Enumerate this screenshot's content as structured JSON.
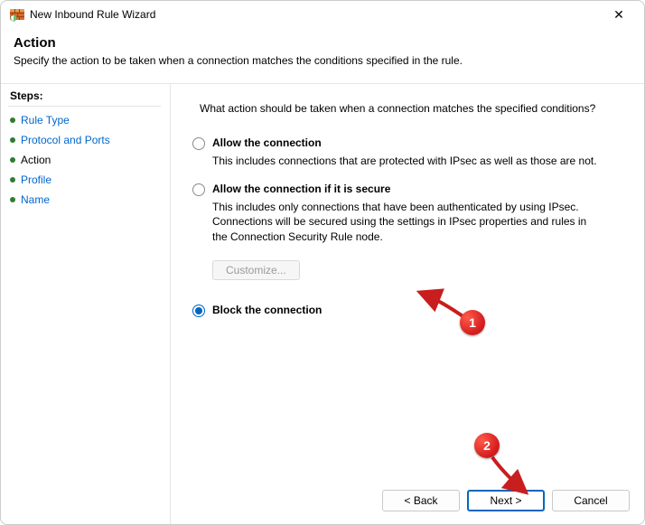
{
  "window": {
    "title": "New Inbound Rule Wizard"
  },
  "header": {
    "title": "Action",
    "description": "Specify the action to be taken when a connection matches the conditions specified in the rule."
  },
  "sidebar": {
    "label": "Steps:",
    "items": [
      {
        "label": "Rule Type",
        "current": false
      },
      {
        "label": "Protocol and Ports",
        "current": false
      },
      {
        "label": "Action",
        "current": true
      },
      {
        "label": "Profile",
        "current": false
      },
      {
        "label": "Name",
        "current": false
      }
    ]
  },
  "content": {
    "prompt": "What action should be taken when a connection matches the specified conditions?",
    "options": [
      {
        "id": "allow",
        "label": "Allow the connection",
        "description": "This includes connections that are protected with IPsec as well as those are not.",
        "selected": false
      },
      {
        "id": "allow-secure",
        "label": "Allow the connection if it is secure",
        "description": "This includes only connections that have been authenticated by using IPsec.  Connections will be secured using the settings in IPsec properties and rules in the Connection Security Rule node.",
        "selected": false,
        "customize_label": "Customize...",
        "customize_enabled": false
      },
      {
        "id": "block",
        "label": "Block the connection",
        "description": "",
        "selected": true
      }
    ]
  },
  "footer": {
    "back_label": "< Back",
    "next_label": "Next >",
    "cancel_label": "Cancel"
  },
  "annotations": {
    "badge1": "1",
    "badge2": "2"
  },
  "colors": {
    "link": "#0066cc",
    "accent": "#0067c0",
    "step_bullet": "#2f7d2f",
    "annotation": "#d61f1f"
  }
}
